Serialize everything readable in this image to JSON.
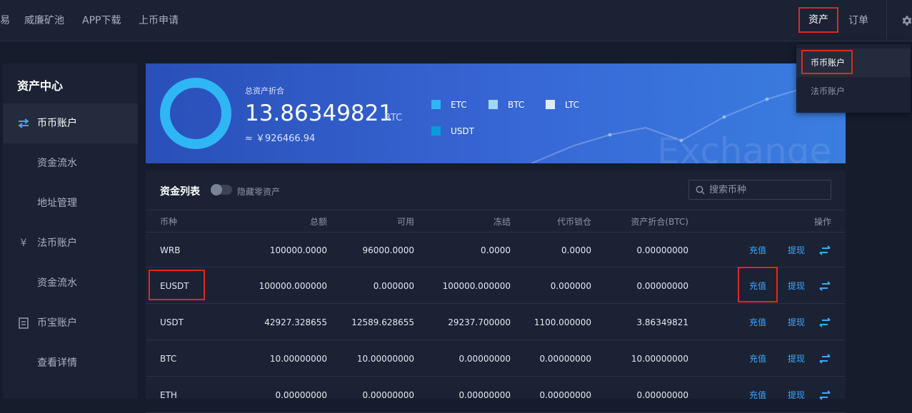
{
  "nav": {
    "items": [
      "易",
      "威廉矿池",
      "APP下载",
      "上币申请"
    ],
    "assets": "资产",
    "orders": "订单"
  },
  "dropdown": {
    "coin_account": "币币账户",
    "fiat_account": "法币账户"
  },
  "sidebar": {
    "title": "资产中心",
    "items": [
      {
        "label": "币币账户",
        "icon": "exchange-icon"
      },
      {
        "label": "资金流水"
      },
      {
        "label": "地址管理"
      },
      {
        "label": "法币账户",
        "icon": "yen-icon"
      },
      {
        "label": "资金流水"
      },
      {
        "label": "币宝账户",
        "icon": "document-icon"
      },
      {
        "label": "查看详情"
      }
    ]
  },
  "banner": {
    "label": "总资产折合",
    "value": "13.86349821",
    "unit": "BTC",
    "cny": "≈ ￥926466.94",
    "legend": [
      {
        "name": "ETC",
        "color": "#2fb6f5"
      },
      {
        "name": "BTC",
        "color": "#9fd8f5"
      },
      {
        "name": "LTC",
        "color": "#dcecfa"
      },
      {
        "name": "USDT",
        "color": "#0a9bdc"
      }
    ],
    "watermark": "Exchange"
  },
  "assets": {
    "title": "资金列表",
    "hide_zero": "隐藏零资产",
    "search_placeholder": "搜索币种",
    "columns": [
      "币种",
      "总额",
      "可用",
      "冻结",
      "代币锁仓",
      "资产折合(BTC)",
      "操作"
    ],
    "deposit": "充值",
    "withdraw": "提现",
    "rows": [
      [
        "WRB",
        "100000.0000",
        "96000.0000",
        "0.0000",
        "0.0000",
        "0.00000000"
      ],
      [
        "EUSDT",
        "100000.000000",
        "0.000000",
        "100000.000000",
        "0.000000",
        "0.00000000"
      ],
      [
        "USDT",
        "42927.328655",
        "12589.628655",
        "29237.700000",
        "1100.000000",
        "3.86349821"
      ],
      [
        "BTC",
        "10.00000000",
        "10.00000000",
        "0.00000000",
        "0.00000000",
        "10.00000000"
      ],
      [
        "ETH",
        "0.00000000",
        "0.00000000",
        "0.00000000",
        "0.00000000",
        "0.00000000"
      ]
    ]
  },
  "colors": {
    "accent": "#3ea6ff",
    "highlight": "#e0281e"
  }
}
